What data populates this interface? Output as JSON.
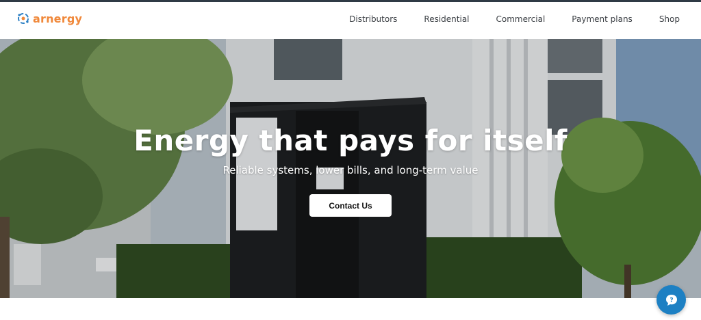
{
  "brand": {
    "name": "arnergy",
    "logo_icon": "arnergy-logo-icon",
    "accent": "#f0883a",
    "logo_blue": "#2b7fc4"
  },
  "nav": {
    "items": [
      {
        "label": "Distributors"
      },
      {
        "label": "Residential"
      },
      {
        "label": "Commercial"
      },
      {
        "label": "Payment plans"
      },
      {
        "label": "Shop"
      }
    ]
  },
  "hero": {
    "title": "Energy that pays for itself",
    "subtitle": "Reliable systems, lower bills, and long-term value",
    "cta_label": "Contact Us"
  },
  "chat": {
    "icon": "chat-help-icon",
    "color": "#1d80c3"
  }
}
